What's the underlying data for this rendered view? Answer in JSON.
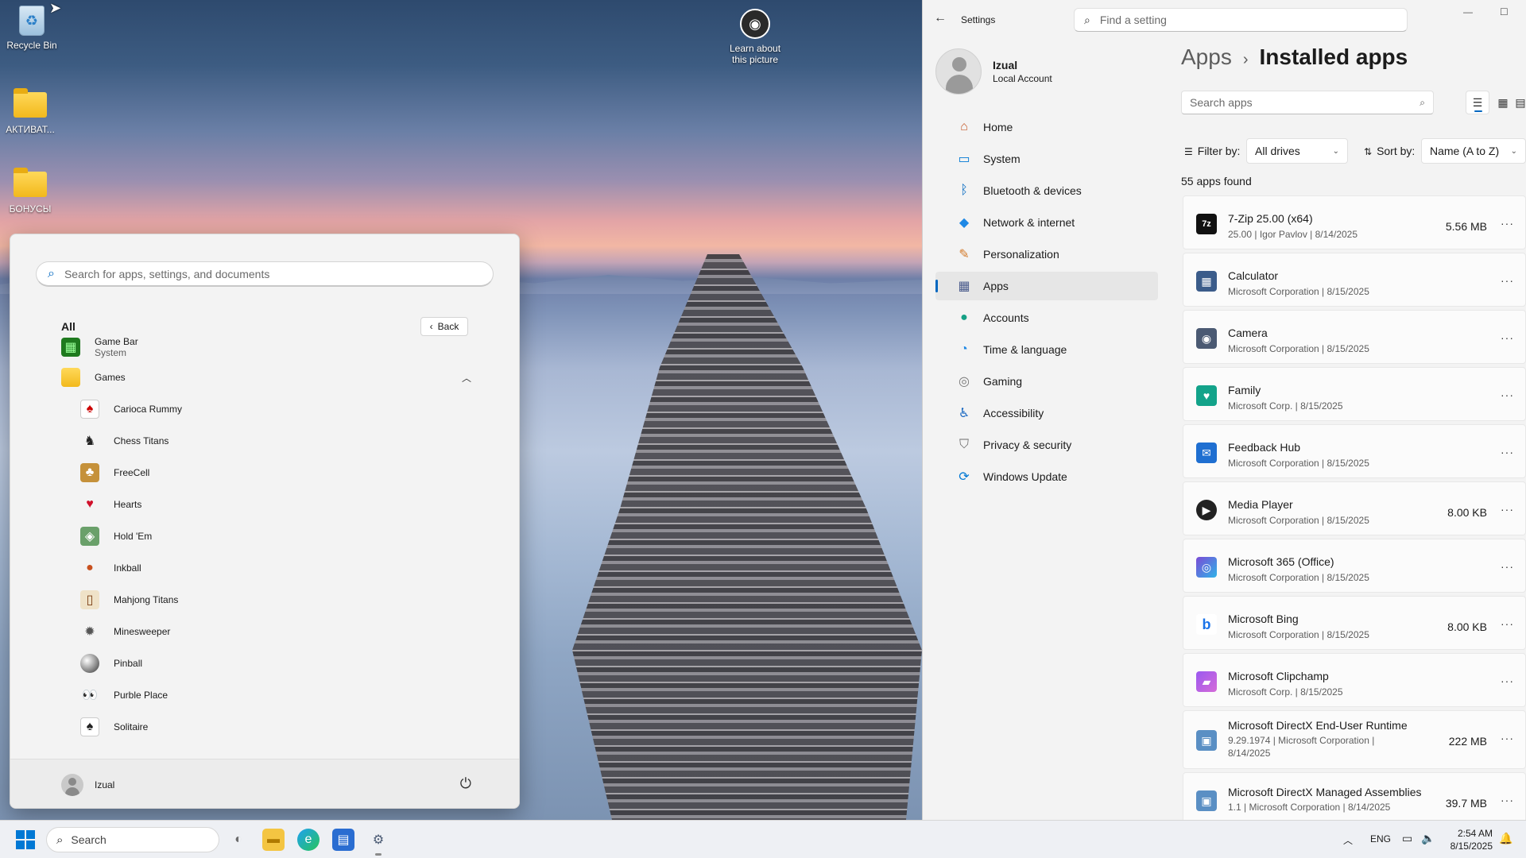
{
  "desktop": {
    "icons": [
      {
        "label": "Recycle Bin"
      },
      {
        "label": "АКТИВАТ..."
      },
      {
        "label": "БОНУСЫ"
      },
      {
        "label": "Learn about this picture"
      }
    ]
  },
  "start_menu": {
    "search_placeholder": "Search for apps, settings, and documents",
    "section_title": "All",
    "back_label": "Back",
    "items": [
      {
        "name": "Game Bar",
        "sub": "System"
      },
      {
        "name": "Games"
      },
      {
        "name": "Carioca Rummy"
      },
      {
        "name": "Chess Titans"
      },
      {
        "name": "FreeCell"
      },
      {
        "name": "Hearts"
      },
      {
        "name": "Hold 'Em"
      },
      {
        "name": "Inkball"
      },
      {
        "name": "Mahjong Titans"
      },
      {
        "name": "Minesweeper"
      },
      {
        "name": "Pinball"
      },
      {
        "name": "Purble Place"
      },
      {
        "name": "Solitaire"
      }
    ],
    "user_name": "Izual"
  },
  "settings": {
    "title": "Settings",
    "search_placeholder": "Find a setting",
    "profile": {
      "name": "Izual",
      "account": "Local Account"
    },
    "nav": [
      {
        "label": "Home",
        "icon": "home-icon"
      },
      {
        "label": "System",
        "icon": "monitor-icon"
      },
      {
        "label": "Bluetooth & devices",
        "icon": "bluetooth-icon"
      },
      {
        "label": "Network & internet",
        "icon": "wifi-icon"
      },
      {
        "label": "Personalization",
        "icon": "brush-icon"
      },
      {
        "label": "Apps",
        "icon": "apps-icon"
      },
      {
        "label": "Accounts",
        "icon": "person-icon"
      },
      {
        "label": "Time & language",
        "icon": "globe-clock-icon"
      },
      {
        "label": "Gaming",
        "icon": "gamepad-icon"
      },
      {
        "label": "Accessibility",
        "icon": "accessibility-icon"
      },
      {
        "label": "Privacy & security",
        "icon": "shield-icon"
      },
      {
        "label": "Windows Update",
        "icon": "update-icon"
      }
    ],
    "active_nav": "Apps",
    "breadcrumb": {
      "parent": "Apps",
      "current": "Installed apps"
    },
    "app_search_placeholder": "Search apps",
    "filter": {
      "label": "Filter by:",
      "value": "All drives"
    },
    "sort": {
      "label": "Sort by:",
      "value": "Name (A to Z)"
    },
    "apps_found": "55 apps found",
    "apps": [
      {
        "name": "7-Zip 25.00 (x64)",
        "meta": "25.00  |  Igor Pavlov  |  8/14/2025",
        "size": "5.56 MB",
        "icon": "7zip-icon"
      },
      {
        "name": "Calculator",
        "meta": "Microsoft Corporation  |  8/15/2025",
        "size": "",
        "icon": "calculator-icon"
      },
      {
        "name": "Camera",
        "meta": "Microsoft Corporation  |  8/15/2025",
        "size": "",
        "icon": "camera-icon"
      },
      {
        "name": "Family",
        "meta": "Microsoft Corp.  |  8/15/2025",
        "size": "",
        "icon": "family-heart-icon"
      },
      {
        "name": "Feedback Hub",
        "meta": "Microsoft Corporation  |  8/15/2025",
        "size": "",
        "icon": "feedback-icon"
      },
      {
        "name": "Media Player",
        "meta": "Microsoft Corporation  |  8/15/2025",
        "size": "8.00 KB",
        "icon": "media-player-icon"
      },
      {
        "name": "Microsoft 365 (Office)",
        "meta": "Microsoft Corporation  |  8/15/2025",
        "size": "",
        "icon": "office-icon"
      },
      {
        "name": "Microsoft Bing",
        "meta": "Microsoft Corporation  |  8/15/2025",
        "size": "8.00 KB",
        "icon": "bing-icon"
      },
      {
        "name": "Microsoft Clipchamp",
        "meta": "Microsoft Corp.  |  8/15/2025",
        "size": "",
        "icon": "clipchamp-icon"
      },
      {
        "name": "Microsoft DirectX End-User Runtime",
        "meta": "9.29.1974  |  Microsoft Corporation  |",
        "meta2": "8/14/2025",
        "size": "222 MB",
        "icon": "directx-icon"
      },
      {
        "name": "Microsoft DirectX Managed Assemblies",
        "meta": "1.1  |  Microsoft Corporation  |  8/14/2025",
        "size": "39.7 MB",
        "icon": "directx-icon"
      }
    ]
  },
  "taskbar": {
    "search_label": "Search",
    "language": "ENG",
    "time": "2:54 AM",
    "date": "8/15/2025"
  },
  "colors": {
    "accent": "#0067c0",
    "taskbar": "#eef0f4",
    "panel": "#f3f3f3"
  }
}
